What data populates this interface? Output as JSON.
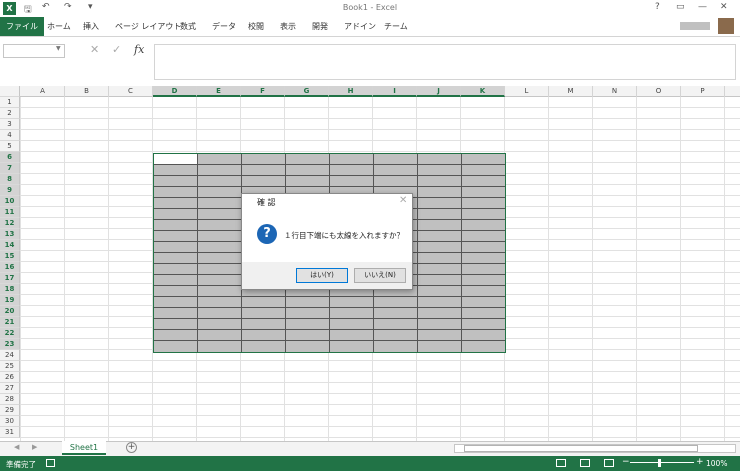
{
  "window": {
    "title": "Book1 - Excel",
    "help": "?"
  },
  "quick_access": {
    "logo": "X",
    "save_icon": "floppy-icon",
    "undo": "↶",
    "redo": "↷",
    "custom": "▾"
  },
  "ribbon_tabs": [
    "ファイル",
    "ホーム",
    "挿入",
    "ページ レイアウト",
    "数式",
    "データ",
    "校閲",
    "表示",
    "開発",
    "アドイン",
    "チーム"
  ],
  "formula_bar": {
    "fx": "fx",
    "cancel": "✕",
    "enter": "✓",
    "value": ""
  },
  "columns": [
    "A",
    "B",
    "C",
    "D",
    "E",
    "F",
    "G",
    "H",
    "I",
    "J",
    "K",
    "L",
    "M",
    "N",
    "O",
    "P"
  ],
  "selected_columns": [
    "D",
    "E",
    "F",
    "G",
    "H",
    "I",
    "J",
    "K"
  ],
  "rows": [
    "1",
    "2",
    "3",
    "4",
    "5",
    "6",
    "7",
    "8",
    "9",
    "10",
    "11",
    "12",
    "13",
    "14",
    "15",
    "16",
    "17",
    "18",
    "19",
    "20",
    "21",
    "22",
    "23",
    "24",
    "25",
    "26",
    "27",
    "28",
    "29",
    "30",
    "31"
  ],
  "selected_rows_range": [
    6,
    23
  ],
  "dialog": {
    "title": "確 認",
    "message": "１行目下端にも太線を入れますか？",
    "yes_button": "はい(Y)",
    "no_button": "いいえ(N)"
  },
  "sheet_tabs": {
    "active": "Sheet1",
    "add": "+"
  },
  "status": {
    "ready": "準備完了",
    "zoom": "100%"
  },
  "colors": {
    "excel_green": "#217346",
    "selection_fill": "#c0c0c0",
    "dialog_icon": "#1c66b5"
  }
}
